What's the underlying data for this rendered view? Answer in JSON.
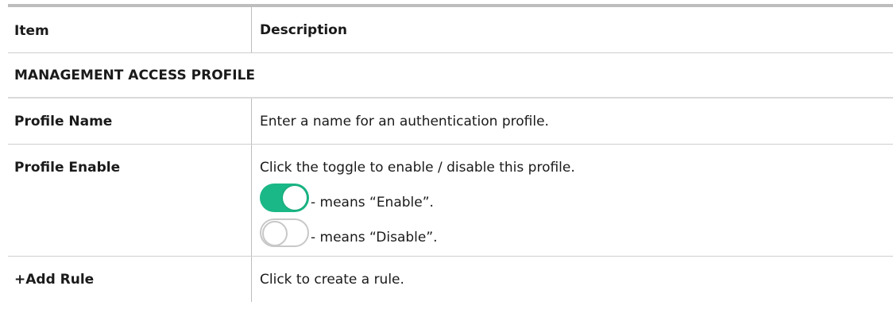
{
  "table": {
    "header": {
      "item": "Item",
      "description": "Description"
    },
    "section": "MANAGEMENT ACCESS PROFILE",
    "rows": [
      {
        "item": "Profile Name",
        "description": "Enter a name for an authentication profile."
      },
      {
        "item": "Profile Enable",
        "description": "Click the toggle to enable / disable this profile.",
        "toggle_on_text": "- means “Enable”.",
        "toggle_off_text": "- means “Disable”."
      },
      {
        "item": "+Add Rule",
        "description": "Click to create a rule."
      }
    ]
  },
  "colors": {
    "toggle_on": "#1ab886",
    "toggle_off_border": "#c8c8c8",
    "rule": "#bdbdbd"
  },
  "icons": {
    "toggle_on": "toggle-on-icon",
    "toggle_off": "toggle-off-icon"
  }
}
